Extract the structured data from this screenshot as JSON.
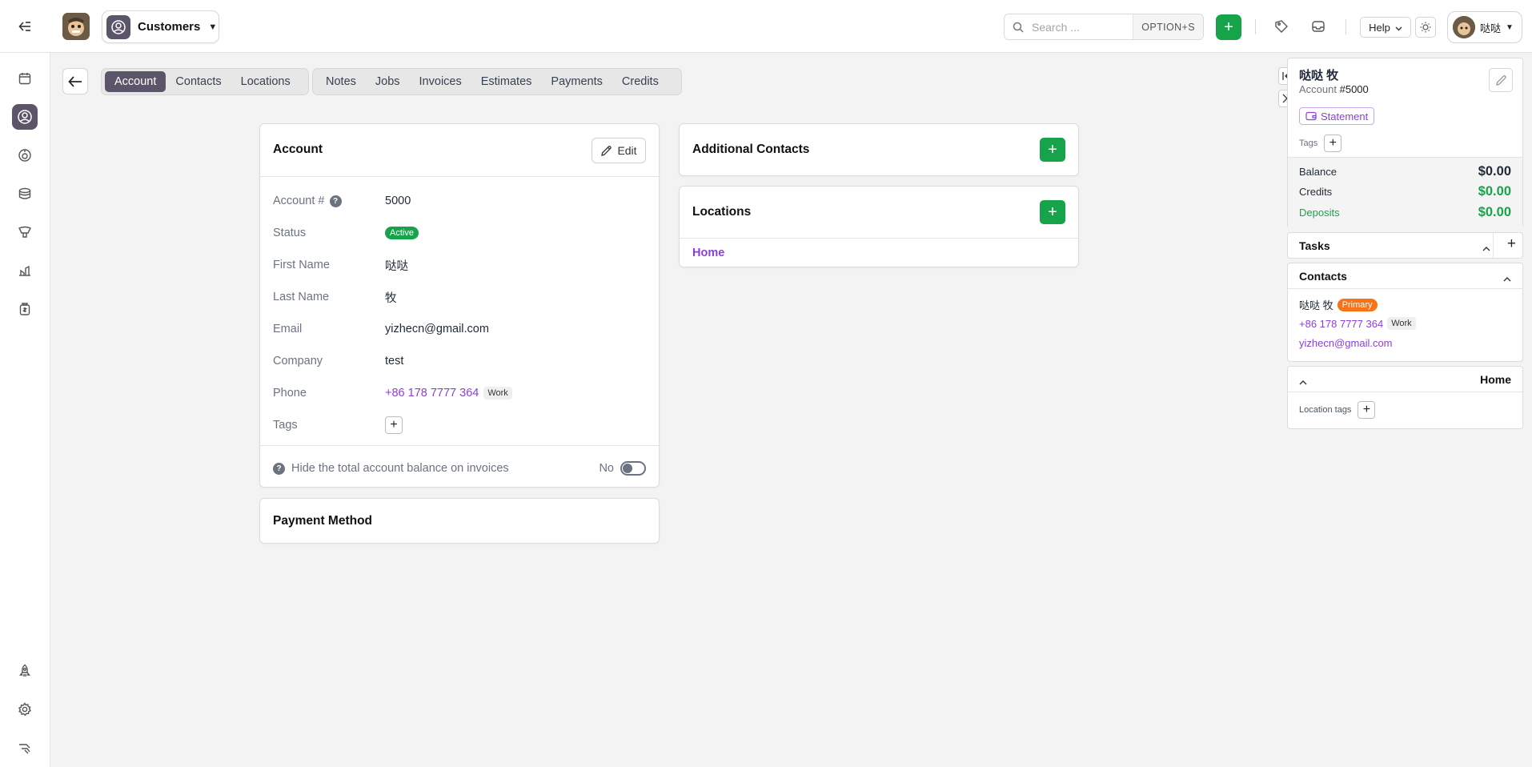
{
  "topbar": {
    "module": "Customers",
    "search_placeholder": "Search ...",
    "search_shortcut": "OPTION+S",
    "help": "Help",
    "user_name": "哒哒"
  },
  "tabs": {
    "group1": [
      "Account",
      "Contacts",
      "Locations"
    ],
    "group2": [
      "Notes",
      "Jobs",
      "Invoices",
      "Estimates",
      "Payments",
      "Credits"
    ],
    "active": "Account"
  },
  "account": {
    "title": "Account",
    "edit": "Edit",
    "fields": {
      "account_label": "Account #",
      "account_value": "5000",
      "status_label": "Status",
      "status_value": "Active",
      "first_label": "First Name",
      "first_value": "哒哒",
      "last_label": "Last Name",
      "last_value": "牧",
      "email_label": "Email",
      "email_value": "yizhecn@gmail.com",
      "company_label": "Company",
      "company_value": "test",
      "phone_label": "Phone",
      "phone_value": "+86 178 7777 364",
      "phone_type": "Work",
      "tags_label": "Tags"
    },
    "hide_balance": "Hide the total account balance on invoices",
    "hide_balance_value": "No"
  },
  "payment_method": {
    "title": "Payment Method"
  },
  "additional_contacts": {
    "title": "Additional Contacts"
  },
  "locations": {
    "title": "Locations",
    "items": [
      "Home"
    ]
  },
  "right_panel": {
    "name": "哒哒 牧",
    "account_label": "Account",
    "account_number": "#5000",
    "statement": "Statement",
    "tags_label": "Tags",
    "balance_label": "Balance",
    "balance": "$0.00",
    "credits_label": "Credits",
    "credits": "$0.00",
    "deposits_label": "Deposits",
    "deposits": "$0.00",
    "tasks_title": "Tasks",
    "contacts_title": "Contacts",
    "contact_name": "哒哒 牧",
    "contact_badge": "Primary",
    "contact_phone": "+86 178 7777 364",
    "contact_phone_type": "Work",
    "contact_email": "yizhecn@gmail.com",
    "location_title": "Home",
    "location_tags_label": "Location tags"
  },
  "colors": {
    "accent_purple": "#8b3fd9",
    "green": "#16a34a",
    "nav_active": "#5a5568",
    "primary_badge": "#f97316"
  }
}
